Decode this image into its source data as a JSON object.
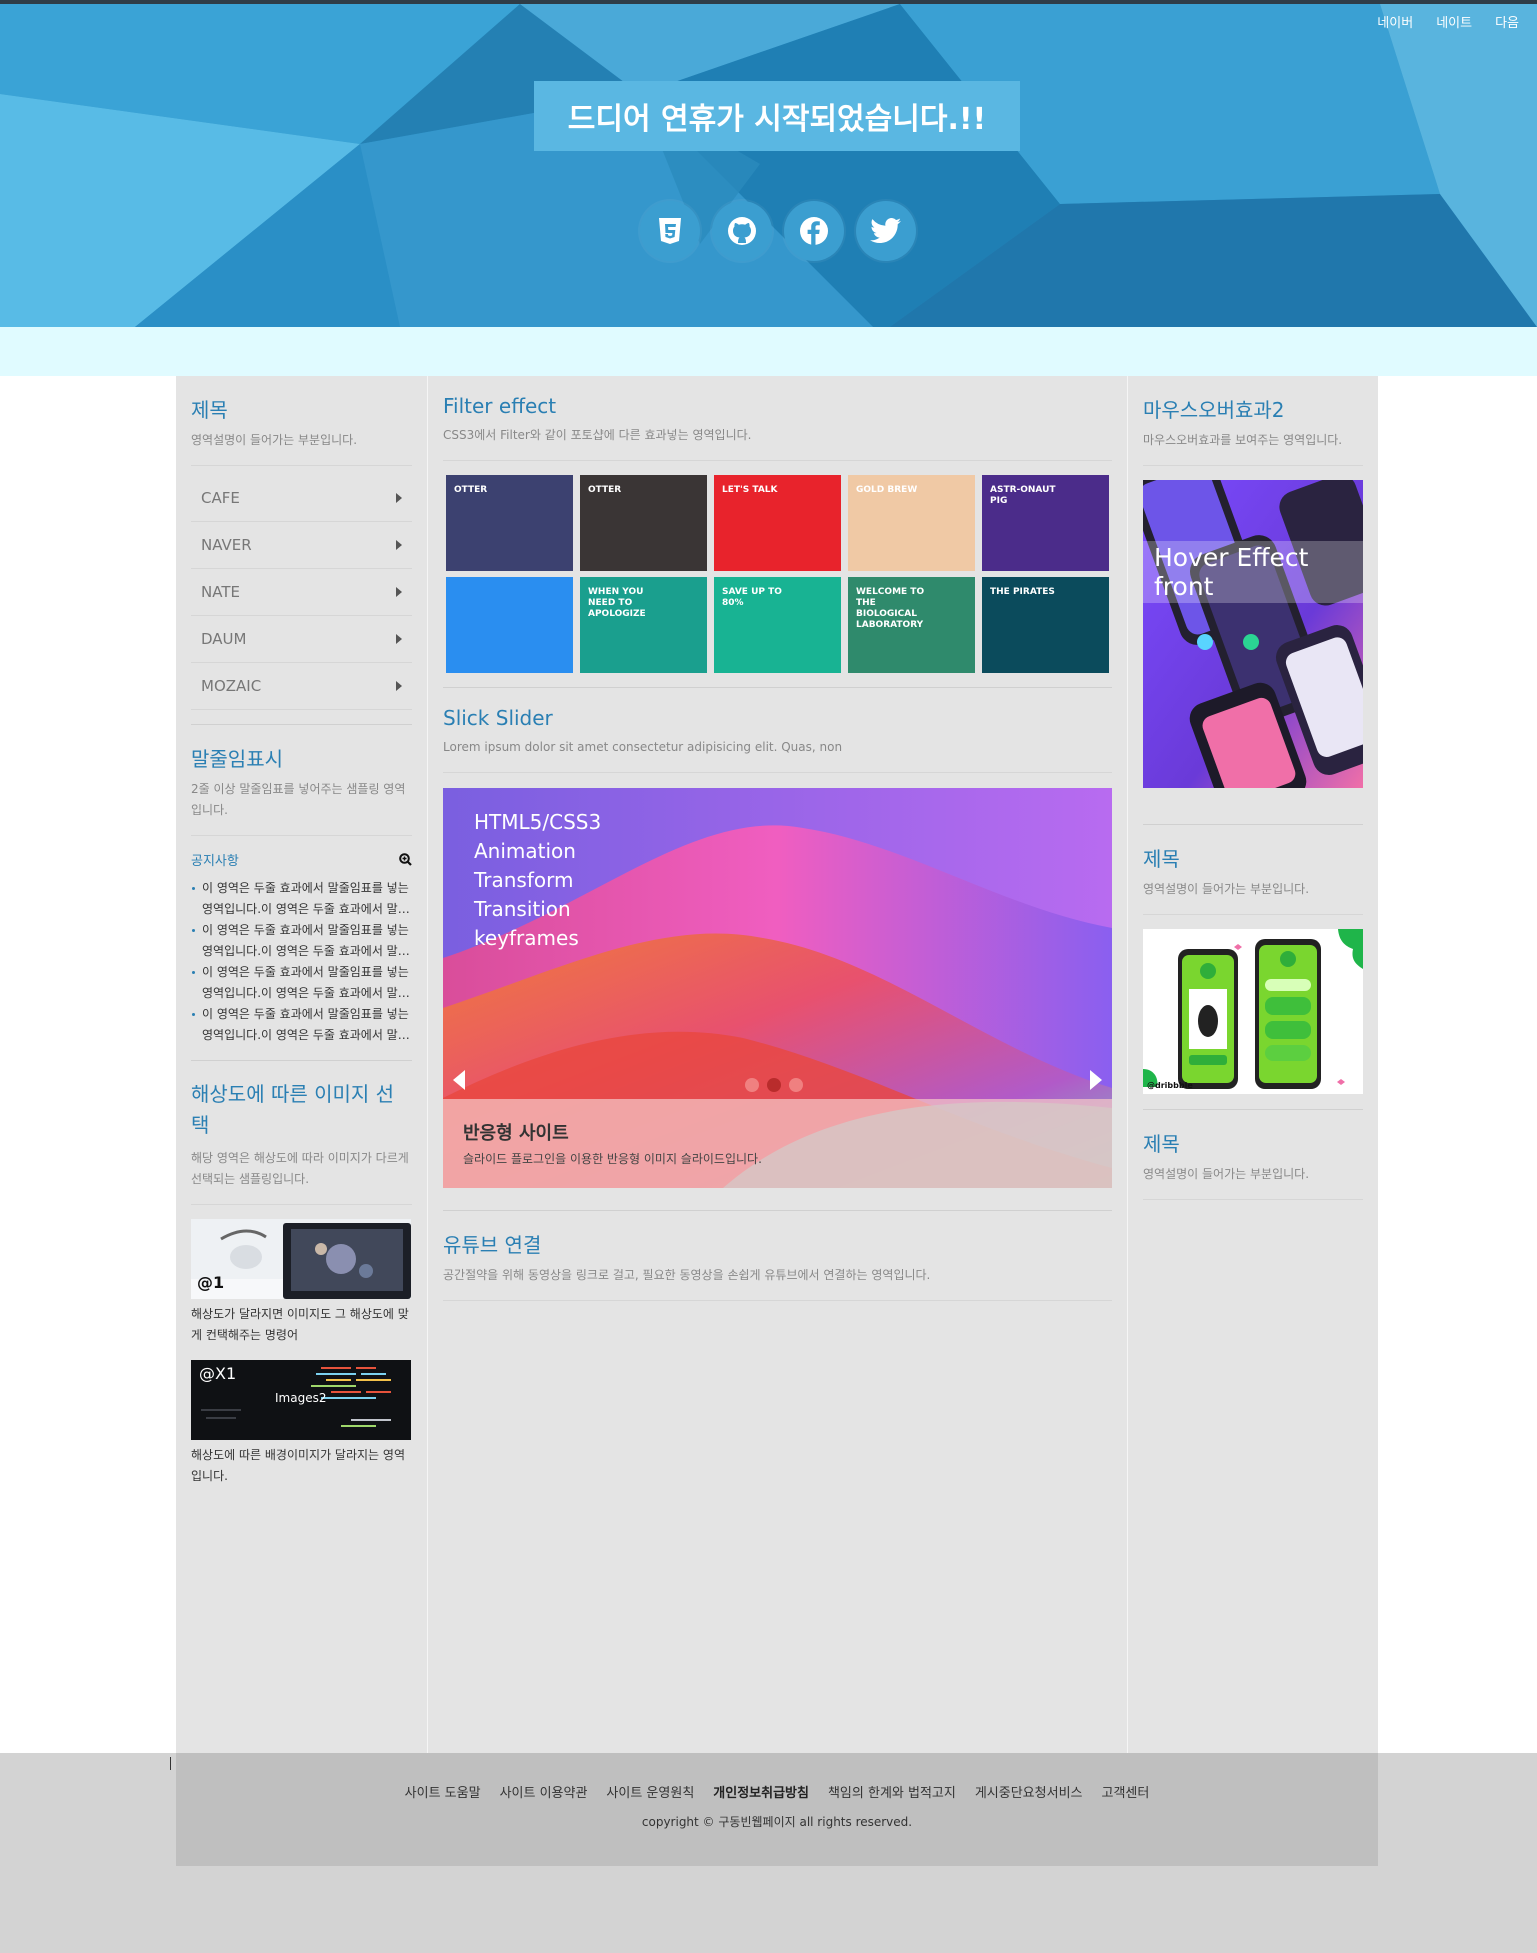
{
  "header": {
    "top_links": [
      "네이버",
      "네이트",
      "다음"
    ],
    "banner": "드디어 연휴가 시작되었습니다.!!",
    "sns_icons": [
      "html5-icon",
      "github-icon",
      "facebook-icon",
      "twitter-icon"
    ]
  },
  "left": {
    "menu_title": "제목",
    "menu_desc": "영역설명이 들어가는 부분입니다.",
    "menu_items": [
      "CAFE",
      "NAVER",
      "NATE",
      "DAUM",
      "MOZAIC"
    ],
    "ellipsis_title": "말줄임표시",
    "ellipsis_desc": "2줄 이상 말줄임표를 넣어주는 샘플링 영역입니다.",
    "notice_label": "공지사항",
    "notice_items": [
      "이 영역은 두줄 효과에서 말줄임표를 넣는 영역입니다.이 영역은 두줄 효과에서 말줄임표를 넣는 영역입니다.",
      "이 영역은 두줄 효과에서 말줄임표를 넣는 영역입니다.이 영역은 두줄 효과에서 말줄임표를 넣는 영역입니다.",
      "이 영역은 두줄 효과에서 말줄임표를 넣는 영역입니다.이 영역은 두줄 효과에서 말줄임표를 넣는 영역입니다.",
      "이 영역은 두줄 효과에서 말줄임표를 넣는 영역입니다.이 영역은 두줄 효과에서 말줄임표를 넣는 영역입니다."
    ],
    "res_title": "해상도에 따른 이미지 선택",
    "res_desc": "해당 영역은 해상도에 따라 이미지가 다르게 선택되는 샘플링입니다.",
    "img1_label": "@1",
    "img1_caption": "해상도가 달라지면 이미지도 그 해상도에 맞게 컨택해주는 명령어",
    "img2_label": "@X1",
    "img2_center": "Images2",
    "img2_caption": "해상도에 따른 배경이미지가 달라지는 영역입니다."
  },
  "center": {
    "filter_title": "Filter effect",
    "filter_desc": "CSS3에서 Filter와 같이 포토샵에 다른 효과넣는 영역입니다.",
    "thumbs": [
      {
        "bg": "#3c4170",
        "label": "OTTER"
      },
      {
        "bg": "#3a3535",
        "label": "OTTER"
      },
      {
        "bg": "#e8232c",
        "label": "LET'S TALK"
      },
      {
        "bg": "#f0c9a5",
        "label": "GOLD BREW"
      },
      {
        "bg": "#4b2c8a",
        "label": "ASTR-ONAUT PIG"
      },
      {
        "bg": "#2a8ef0",
        "label": ""
      },
      {
        "bg": "#1a9f8e",
        "label": "WHEN YOU NEED TO APOLOGIZE"
      },
      {
        "bg": "#18b393",
        "label": "SAVE UP TO 80%"
      },
      {
        "bg": "#2f8a6c",
        "label": "WELCOME TO THE BIOLOGICAL LABORATORY"
      },
      {
        "bg": "#0b4b5c",
        "label": "THE PIRATES"
      }
    ],
    "slick_title": "Slick Slider",
    "slick_desc": "Lorem ipsum dolor sit amet consectetur adipisicing elit. Quas, non",
    "slide_words": [
      "HTML5/CSS3",
      "Animation",
      "Transform",
      "Transition",
      "keyframes"
    ],
    "slide_caption_title": "반응형 사이트",
    "slide_caption_text": "슬라이드 플로그인을 이용한 반응형 이미지 슬라이드입니다.",
    "youtube_title": "유튜브 연결",
    "youtube_desc": "공간절약을 위해 동영상을 링크로 걸고, 필요한 동영상을 손쉽게 유튜브에서 연결하는 영역입니다."
  },
  "right": {
    "hover_title": "마우스오버효과2",
    "hover_desc": "마우스오버효과를 보여주는 영역입니다.",
    "hover_label": "Hover Effect front",
    "sec2_title": "제목",
    "sec2_desc": "영역설명이 들어가는 부분입니다.",
    "dribbble_label": "@dribbble",
    "sec3_title": "제목",
    "sec3_desc": "영역설명이 들어가는 부분입니다."
  },
  "footer": {
    "links": [
      "사이트 도움말",
      "사이트 이용약관",
      "사이트 운영원칙",
      "개인정보취급방침",
      "책임의 한계와 법적고지",
      "게시중단요청서비스",
      "고객센터"
    ],
    "copyright": "copyright © 구동빈웹페이지 all rights reserved."
  },
  "colors": {
    "accent": "#2a7fb3",
    "header": "#2a93c8",
    "strip": "#e0fbff",
    "content_bg": "#e4e4e4"
  }
}
